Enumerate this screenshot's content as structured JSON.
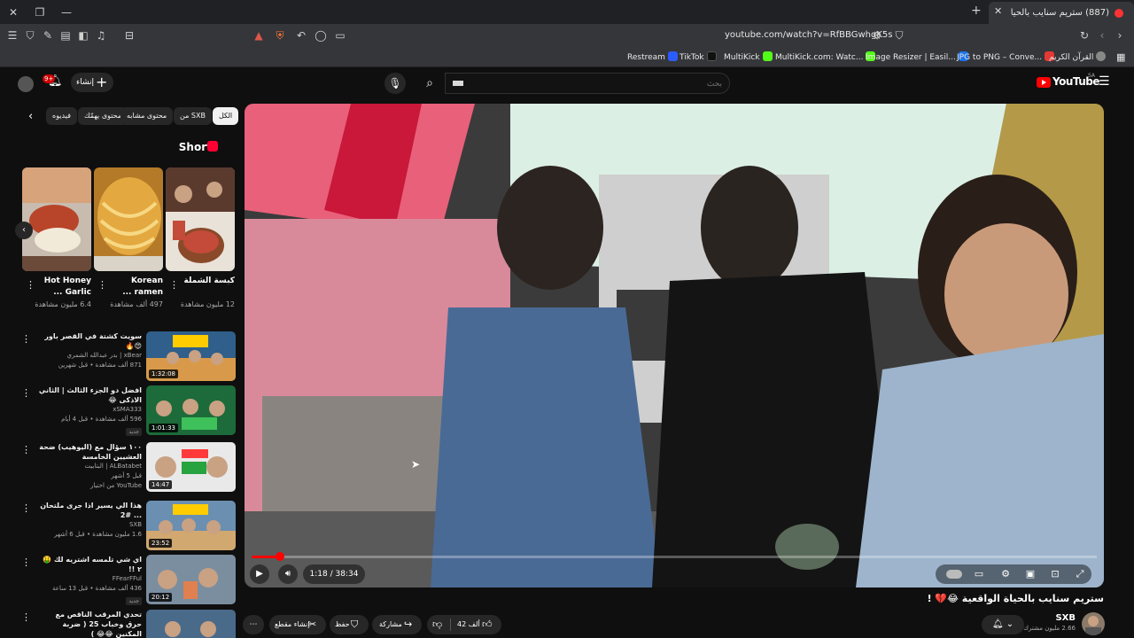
{
  "browser": {
    "tab_title": "(887) ستريم سنايب بالحياة الواقعية",
    "url": "youtube.com/watch?v=RfBBGwhgK5s",
    "bookmarks": [
      {
        "label": "Restream",
        "color": "#2b5cff"
      },
      {
        "label": "TikTok",
        "color": "#111111"
      },
      {
        "label": "MultiKick",
        "color": "#53fc18"
      },
      {
        "label": "MultiKick.com: Watc...",
        "color": "#53fc18"
      },
      {
        "label": "Image Resizer | Easil...",
        "color": "#1a73e8"
      },
      {
        "label": "JPG to PNG – Conve...",
        "color": "#e53935"
      },
      {
        "label": "القرآن الكريم",
        "color": "#888888"
      }
    ]
  },
  "header": {
    "logo_text": "YouTube",
    "region": "SA",
    "search_placeholder": "بحث",
    "create_label": "إنشاء",
    "notif_count": "9+"
  },
  "chips": [
    {
      "label": "الكل",
      "active": true
    },
    {
      "label": "من SXB",
      "active": false
    },
    {
      "label": "محتوى مشابه",
      "active": false
    },
    {
      "label": "محتوى يهمّك",
      "active": false
    },
    {
      "label": "فيديوه",
      "active": false
    }
  ],
  "shorts": {
    "title": "Shorts",
    "items": [
      {
        "title": "كبسة الشملة",
        "views": "12 مليون مشاهدة",
        "thumb_colors": [
          "#5b3a2e",
          "#c44a3a"
        ]
      },
      {
        "title": "Korean ramen ...",
        "views": "497 ألف مشاهدة",
        "thumb_colors": [
          "#c98a2a",
          "#f0c060"
        ]
      },
      {
        "title": "Hot Honey Garlic ...",
        "views": "6.4 مليون مشاهدة",
        "thumb_colors": [
          "#d7a37a",
          "#b8452a"
        ]
      }
    ]
  },
  "recommendations": [
    {
      "title": "سويت كشتة في القصر باور 😍🔥",
      "channel": "xBear | بدر عبدالله الشمري",
      "meta": "871 ألف مشاهدة • قبل شهرين",
      "badge": "",
      "duration": "1:32:08",
      "thumb_colors": [
        "#2f5f8a",
        "#d89a4a"
      ]
    },
    {
      "title": "افضل دو الجزء الثالث | الثاني الاذكى 😂",
      "channel": "xSMA333",
      "meta": "596 ألف مشاهدة • قبل 4 أيام",
      "badge": "جديد",
      "duration": "1:01:33",
      "thumb_colors": [
        "#1d6b3a",
        "#3ec05a"
      ]
    },
    {
      "title": "١٠٠ سؤال مع (اليوهيب) ضحة العشيين الخامسة",
      "channel": "ALBatabet | البتابيت",
      "meta": "قبل 5 أشهر",
      "badge": "YouTube من اختيار",
      "duration": "14:47",
      "thumb_colors": [
        "#e9e9e9",
        "#27a33f"
      ]
    },
    {
      "title": "هذا الي يسير اذا جرى ملتحان ... #2",
      "channel": "SXB",
      "meta": "1.6 مليون مشاهدة • قبل 6 أشهر",
      "badge": "",
      "duration": "23:52",
      "thumb_colors": [
        "#6a8fb0",
        "#d0a870"
      ]
    },
    {
      "title": "اي شي تلمسه اشتريه لك 🤑 ٢ !!",
      "channel": "FFearFFul",
      "meta": "436 ألف مشاهدة • قبل 13 ساعة",
      "badge": "جديد",
      "duration": "20:12",
      "thumb_colors": [
        "#7a8ea0",
        "#e08050"
      ]
    },
    {
      "title": "تحدي المرقب الناقص مع حرق وخباب 25 ( ضربة المكنين 😂😂 )",
      "channel": "xBear",
      "meta": "",
      "badge": "",
      "duration": "",
      "thumb_colors": [
        "#4a6a8a",
        "#c07040"
      ]
    }
  ],
  "player": {
    "time_current": "1:18",
    "time_total": "38:34",
    "time_display": "1:18 / 38:34",
    "progress_fraction": 0.0337
  },
  "video": {
    "title": "ستريم سنايب بالحياة الواقعية 😂💔 !",
    "channel": "SXB",
    "subscribers": "2.66 مليون مشترك",
    "likes": "42 ألف",
    "share_label": "مشاركة",
    "save_label": "حفظ",
    "clip_label": "إنشاء مقطع"
  },
  "colors": {
    "accent": "#ff0000",
    "background": "#0f0f0f",
    "surface": "#272727"
  }
}
